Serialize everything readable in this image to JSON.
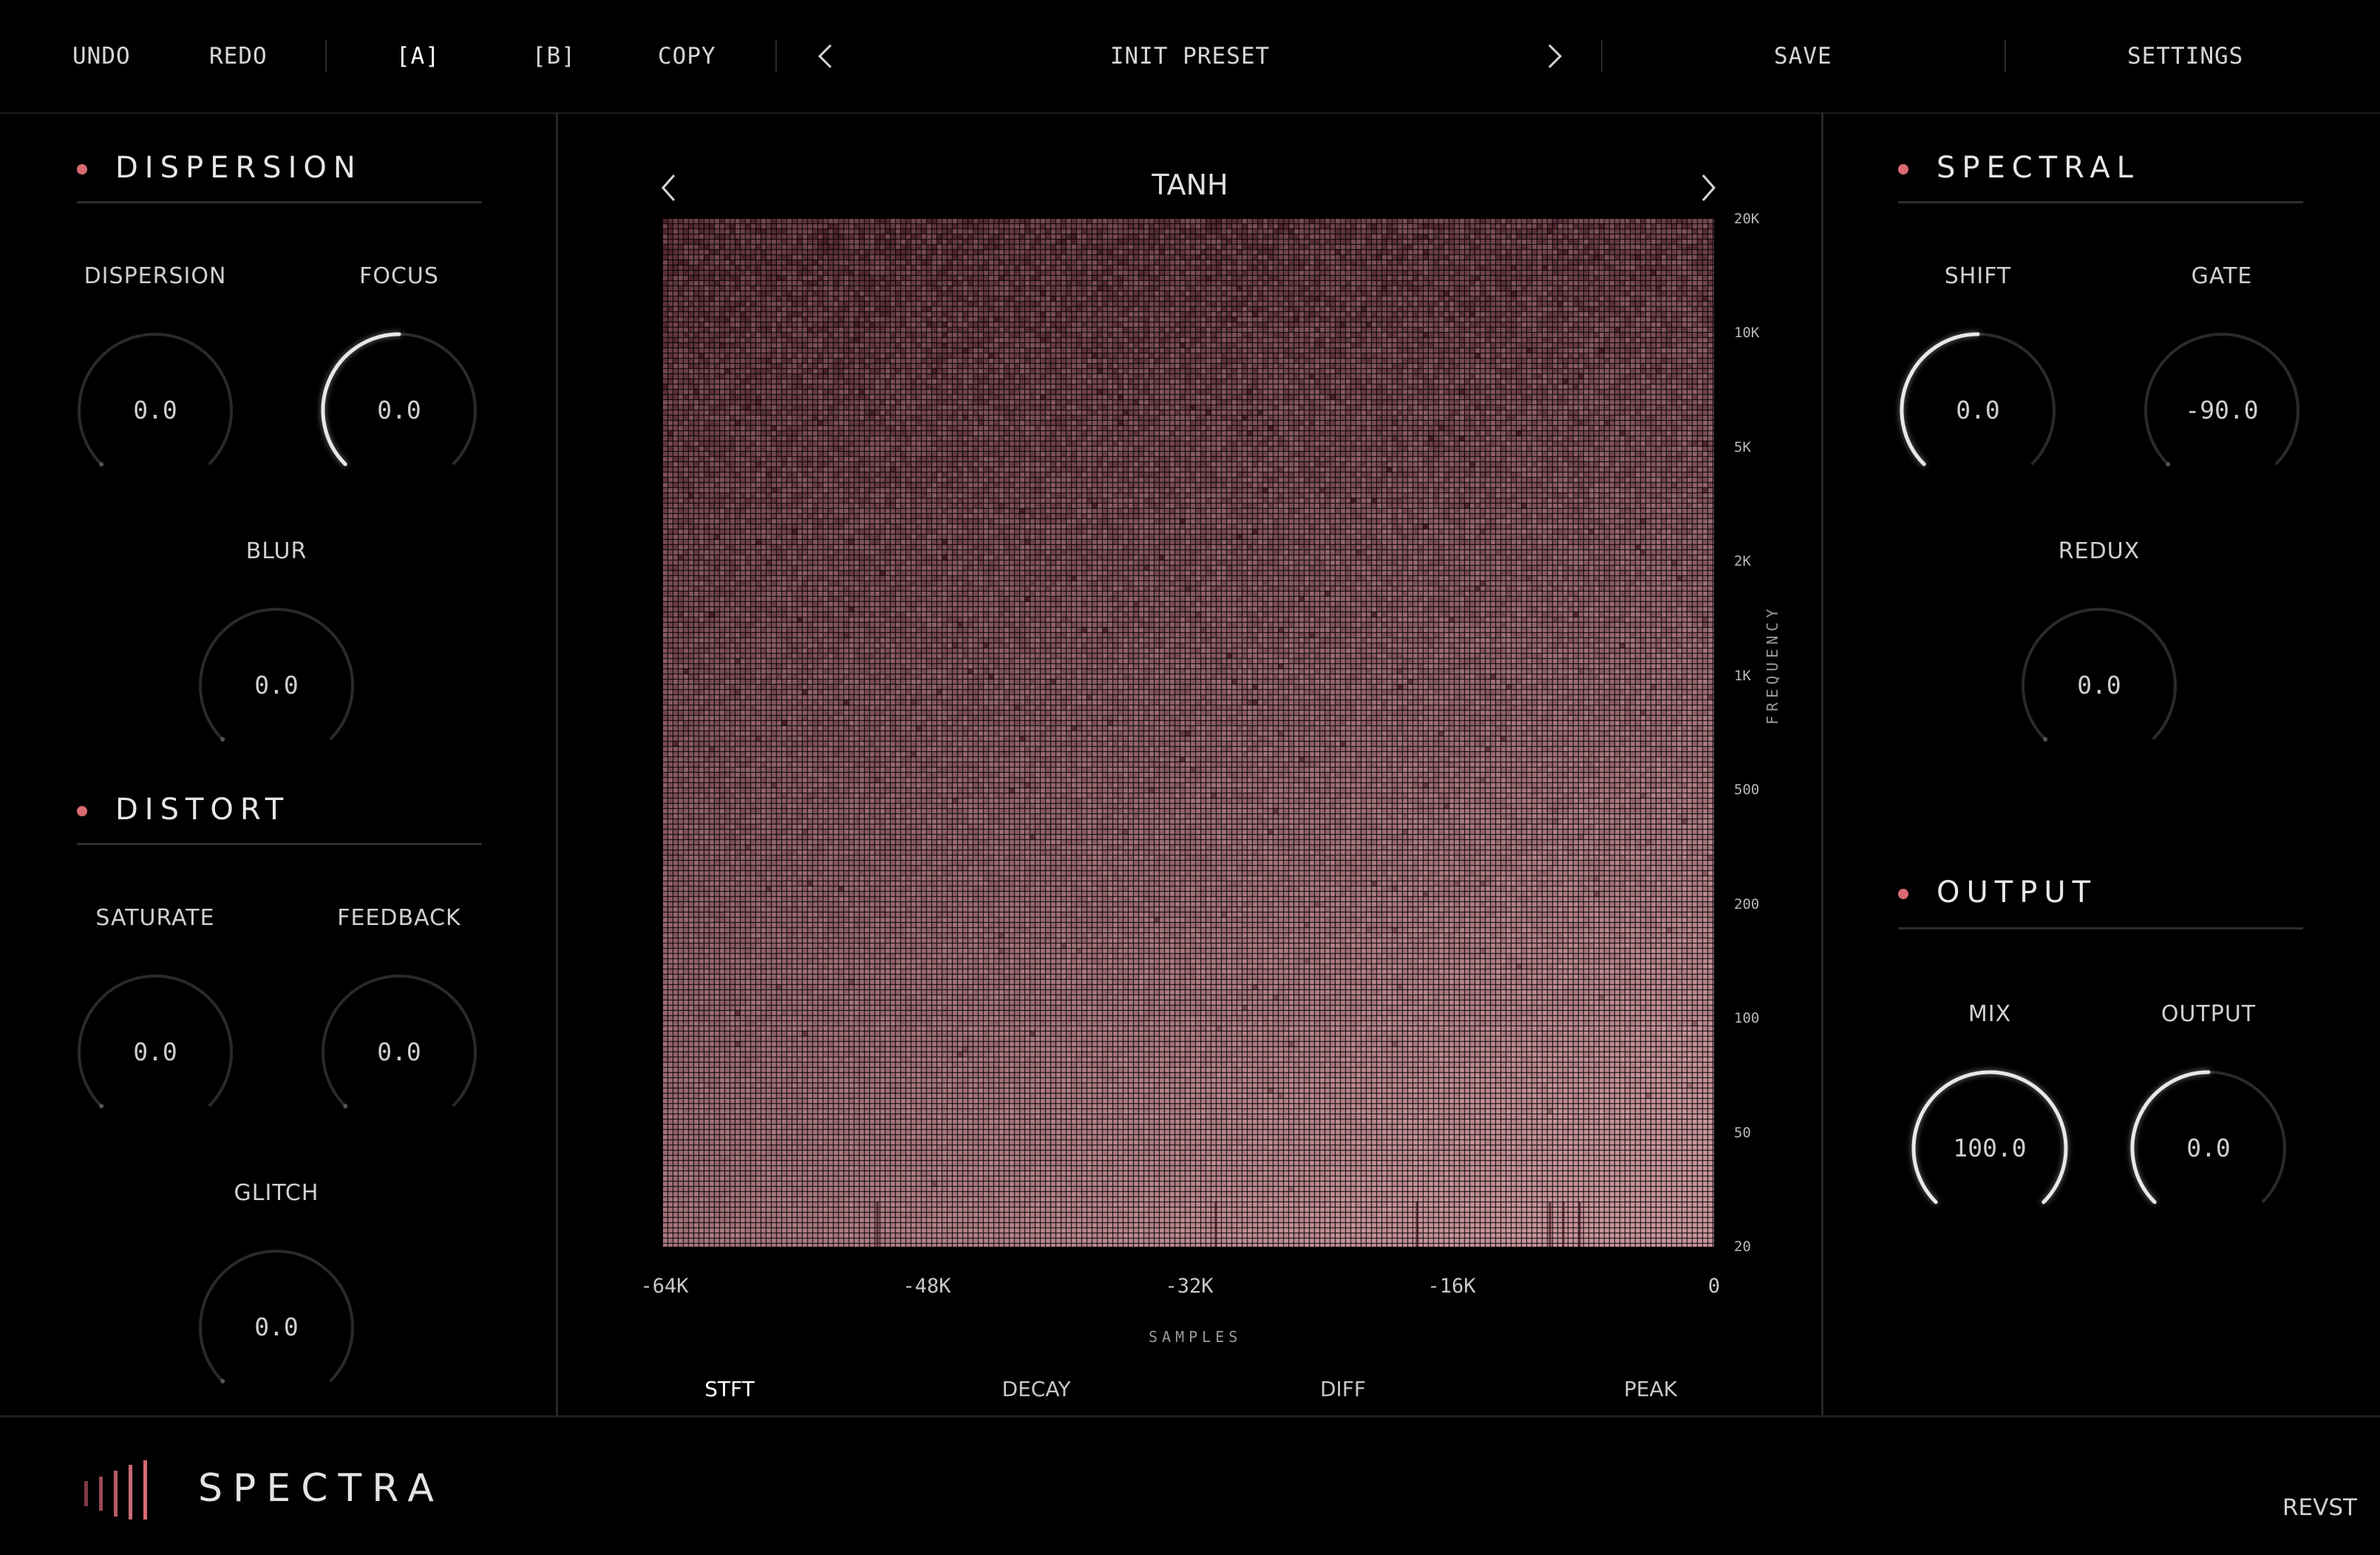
{
  "toolbar": {
    "undo": "UNDO",
    "redo": "REDO",
    "slot_a": "[A]",
    "slot_b": "[B]",
    "copy": "COPY",
    "preset_name": "INIT PRESET",
    "save": "SAVE",
    "settings": "SETTINGS"
  },
  "dispersion": {
    "title": "DISPERSION",
    "knobs": [
      {
        "label": "DISPERSION",
        "value": "0.0",
        "level": 0.0
      },
      {
        "label": "FOCUS",
        "value": "0.0",
        "level": 0.5
      },
      {
        "label": "BLUR",
        "value": "0.0",
        "level": 0.0
      }
    ]
  },
  "distort": {
    "title": "DISTORT",
    "knobs": [
      {
        "label": "SATURATE",
        "value": "0.0",
        "level": 0.0
      },
      {
        "label": "FEEDBACK",
        "value": "0.0",
        "level": 0.0
      },
      {
        "label": "GLITCH",
        "value": "0.0",
        "level": 0.0
      }
    ]
  },
  "spectral": {
    "title": "SPECTRAL",
    "knobs": [
      {
        "label": "SHIFT",
        "value": "0.0",
        "level": 0.5
      },
      {
        "label": "GATE",
        "value": "-90.0",
        "level": 0.0
      },
      {
        "label": "REDUX",
        "value": "0.0",
        "level": 0.0
      }
    ]
  },
  "output": {
    "title": "OUTPUT",
    "knobs": [
      {
        "label": "MIX",
        "value": "100.0",
        "level": 1.0
      },
      {
        "label": "OUTPUT",
        "value": "0.0",
        "level": 0.5
      }
    ]
  },
  "display": {
    "mode_title": "TANH",
    "frequency_ticks": [
      "20K",
      "10K",
      "5K",
      "2K",
      "1K",
      "500",
      "200",
      "100",
      "50",
      "20"
    ],
    "frequency_title": "FREQUENCY",
    "sample_ticks": [
      "-64K",
      "-48K",
      "-32K",
      "-16K",
      "0"
    ],
    "samples_title": "SAMPLES",
    "tabs": [
      "STFT",
      "DECAY",
      "DIFF",
      "PEAK"
    ],
    "active_tab": "STFT"
  },
  "footer": {
    "brand": "SPECTRA",
    "maker": "REVST"
  },
  "colors": {
    "accent": "#d96b72",
    "spectrogram_light": "#c8959b",
    "spectrogram_dark": "#4a1f28",
    "knob_track": "#2a2a2a",
    "knob_arc": "#e8e8e8"
  }
}
